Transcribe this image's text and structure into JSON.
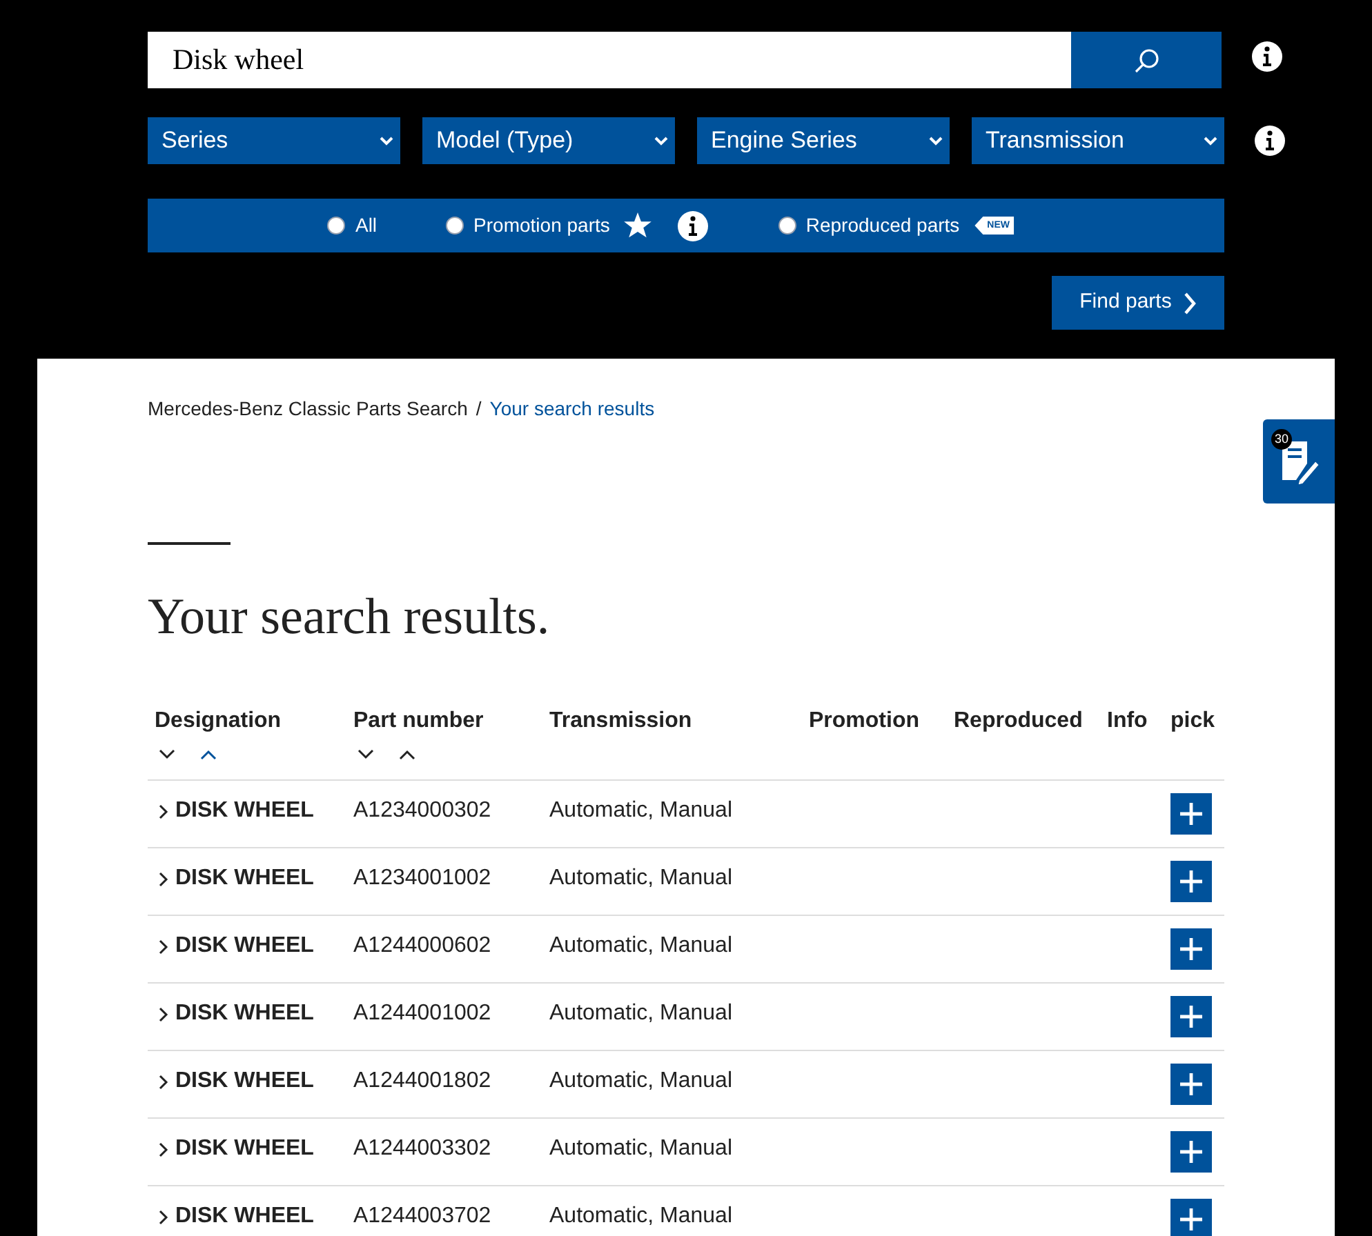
{
  "search": {
    "value": "Disk wheel"
  },
  "filters": [
    {
      "label": "Series"
    },
    {
      "label": "Model (Type)"
    },
    {
      "label": "Engine Series"
    },
    {
      "label": "Transmission"
    }
  ],
  "part_types": [
    {
      "label": "All",
      "selected": false,
      "kind": "plain"
    },
    {
      "label": "Promotion parts",
      "selected": false,
      "kind": "promotion"
    },
    {
      "label": "Reproduced parts",
      "selected": false,
      "kind": "reproduced",
      "badge": "NEW"
    }
  ],
  "find_button": "Find parts",
  "notepad": {
    "count": "30"
  },
  "breadcrumb_separator": "/",
  "breadcrumb": [
    {
      "label": "Mercedes-Benz Classic Parts Search",
      "current": false
    },
    {
      "label": "Your search results",
      "current": true
    }
  ],
  "heading": "Your search results.",
  "table": {
    "columns": [
      {
        "label": "Designation",
        "sort": {
          "desc_selected": false,
          "asc_selected": true
        }
      },
      {
        "label": "Part number",
        "sort": {
          "desc_selected": false,
          "asc_selected": false
        }
      },
      {
        "label": "Transmission"
      },
      {
        "label": "Promotion"
      },
      {
        "label": "Reproduced"
      },
      {
        "label": "Info"
      },
      {
        "label": "pick"
      }
    ],
    "rows": [
      {
        "designation": "DISK WHEEL",
        "part_number": "A1234000302",
        "transmission": "Automatic, Manual"
      },
      {
        "designation": "DISK WHEEL",
        "part_number": "A1234001002",
        "transmission": "Automatic, Manual"
      },
      {
        "designation": "DISK WHEEL",
        "part_number": "A1244000602",
        "transmission": "Automatic, Manual"
      },
      {
        "designation": "DISK WHEEL",
        "part_number": "A1244001002",
        "transmission": "Automatic, Manual"
      },
      {
        "designation": "DISK WHEEL",
        "part_number": "A1244001802",
        "transmission": "Automatic, Manual"
      },
      {
        "designation": "DISK WHEEL",
        "part_number": "A1244003302",
        "transmission": "Automatic, Manual"
      },
      {
        "designation": "DISK WHEEL",
        "part_number": "A1244003702",
        "transmission": "Automatic, Manual"
      }
    ]
  }
}
